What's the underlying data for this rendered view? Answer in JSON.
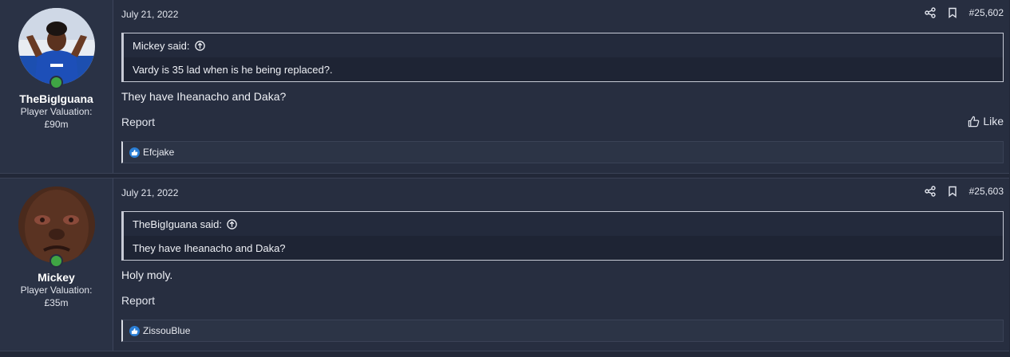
{
  "posts": [
    {
      "user": {
        "name": "TheBigIguana",
        "valuation_label": "Player Valuation:",
        "valuation_value": "£90m"
      },
      "date": "July 21, 2022",
      "post_number": "#25,602",
      "quote": {
        "author": "Mickey said:",
        "text": "Vardy is 35 lad when is he being replaced?."
      },
      "message": "They have Iheanacho and Daka?",
      "report_label": "Report",
      "like_label": "Like",
      "reactions": "Efcjake"
    },
    {
      "user": {
        "name": "Mickey",
        "valuation_label": "Player Valuation:",
        "valuation_value": "£35m"
      },
      "date": "July 21, 2022",
      "post_number": "#25,603",
      "quote": {
        "author": "TheBigIguana said:",
        "text": "They have Iheanacho and Daka?"
      },
      "message": "Holy moly.",
      "report_label": "Report",
      "reactions": "ZissouBlue"
    }
  ],
  "colors": {
    "background": "#222838",
    "post_bg": "#272e40",
    "online": "#3fa544",
    "like_badge": "#2b7fd6"
  },
  "icons": [
    "share-icon",
    "bookmark-icon",
    "arrow-up-circle-icon",
    "thumbs-up-icon",
    "online-status-icon"
  ]
}
